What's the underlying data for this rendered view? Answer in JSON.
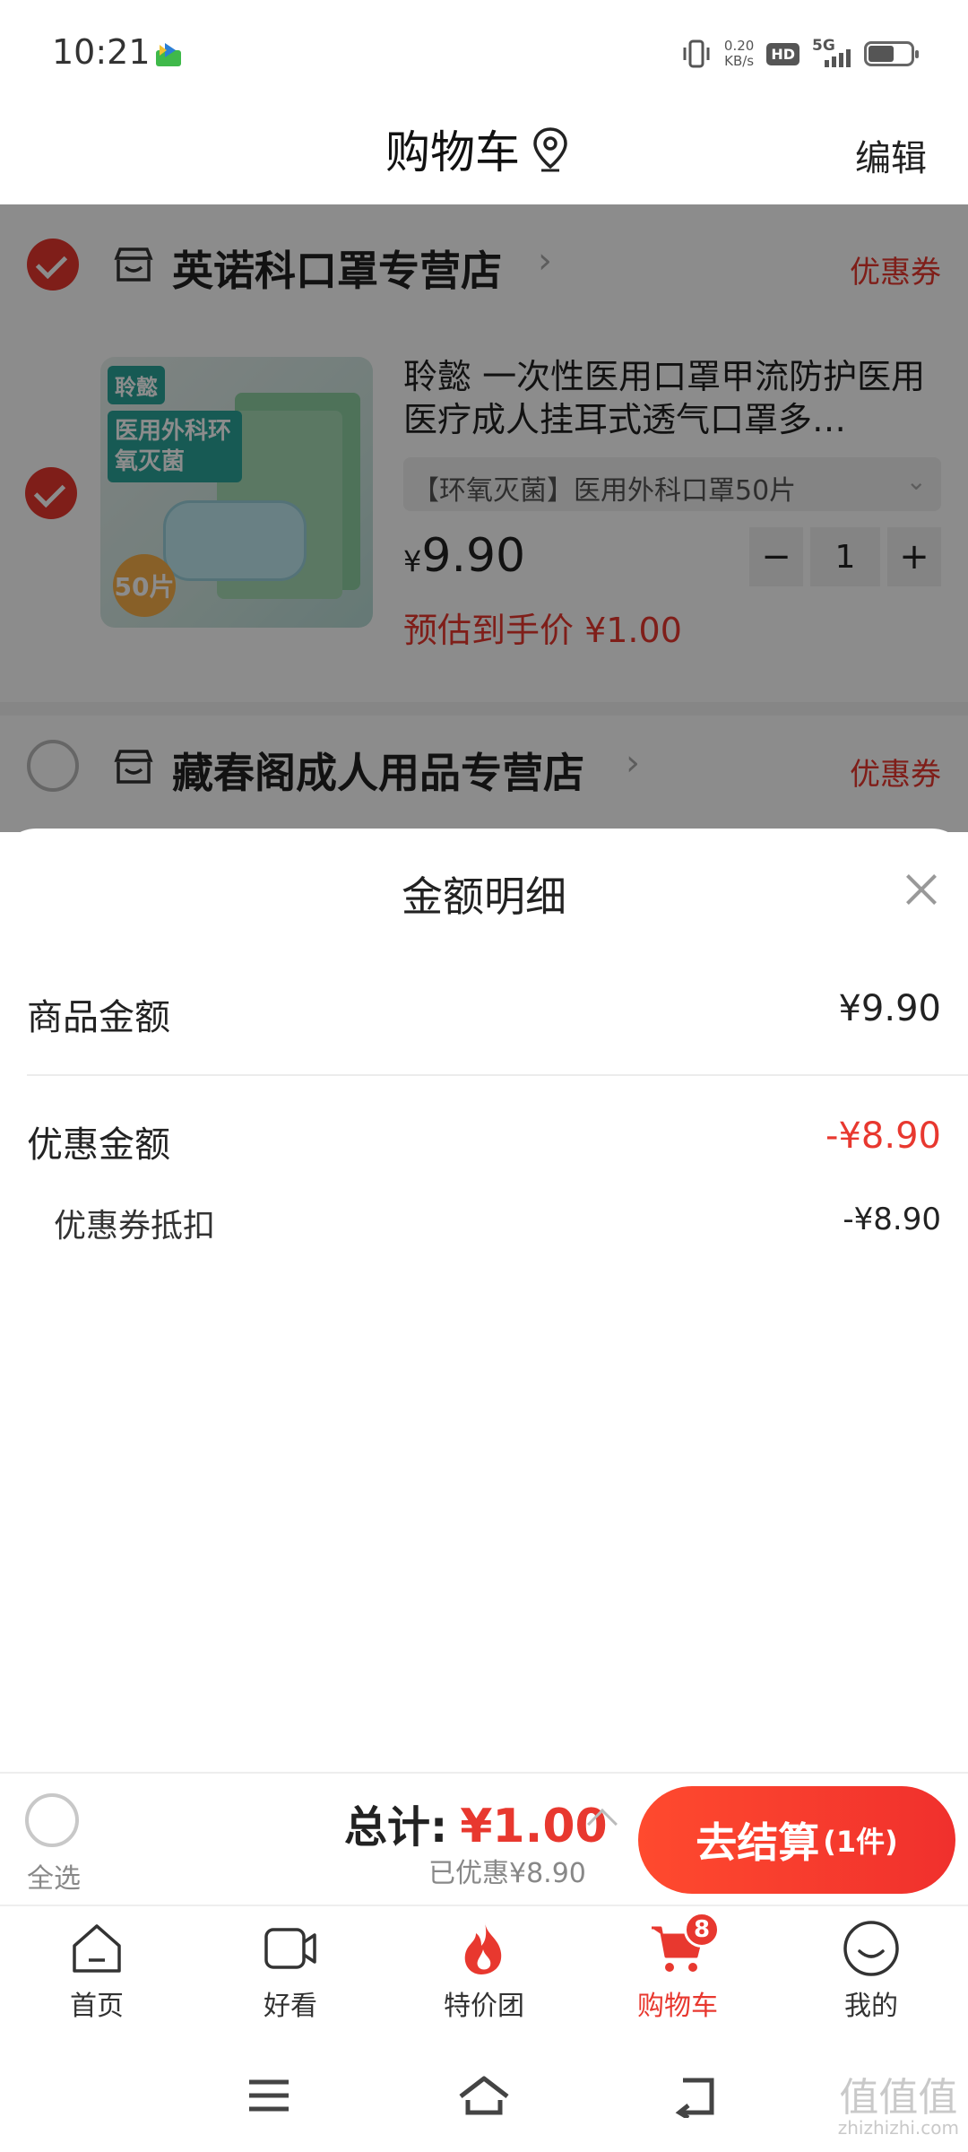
{
  "status_bar": {
    "time": "10:21",
    "net_speed_value": "0.20",
    "net_speed_unit": "KB/s",
    "hd": "HD",
    "network": "5G"
  },
  "header": {
    "title": "购物车",
    "edit": "编辑"
  },
  "stores": [
    {
      "name": "英诺科口罩专营店",
      "coupon": "优惠券",
      "selected": true,
      "item": {
        "title": "聆懿 一次性医用口罩甲流防护医用医疗成人挂耳式透气口罩多…",
        "spec": "【环氧灭菌】医用外科口罩50片",
        "price_currency": "¥",
        "price_value": "9.90",
        "quantity": "1",
        "estimated_price": "预估到手价 ¥1.00",
        "image_text": {
          "brand": "聆懿",
          "title": "医用外科环氧灭菌",
          "count": "50片"
        }
      }
    },
    {
      "name": "藏春阁成人用品专营店",
      "coupon": "优惠券",
      "selected": false
    }
  ],
  "sheet": {
    "title": "金额明细",
    "goods_label": "商品金额",
    "goods_value": "¥9.90",
    "discount_label": "优惠金额",
    "discount_value": "-¥8.90",
    "coupon_label": "优惠券抵扣",
    "coupon_value": "-¥8.90"
  },
  "checkout": {
    "select_all": "全选",
    "total_label": "总计:",
    "total_value": "¥1.00",
    "saved": "已优惠¥8.90",
    "button_label": "去结算",
    "button_count": "(1件)"
  },
  "tabs": [
    {
      "label": "首页",
      "icon": "home-icon"
    },
    {
      "label": "好看",
      "icon": "video-icon"
    },
    {
      "label": "特价团",
      "icon": "flame-icon"
    },
    {
      "label": "购物车",
      "icon": "cart-icon",
      "badge": "8",
      "active": true
    },
    {
      "label": "我的",
      "icon": "smile-icon"
    }
  ],
  "watermark": {
    "main": "值值值",
    "sub": "zhizhizhi.com"
  },
  "colors": {
    "accent": "#e8382f",
    "overlay": "rgba(0,0,0,0.45)"
  }
}
